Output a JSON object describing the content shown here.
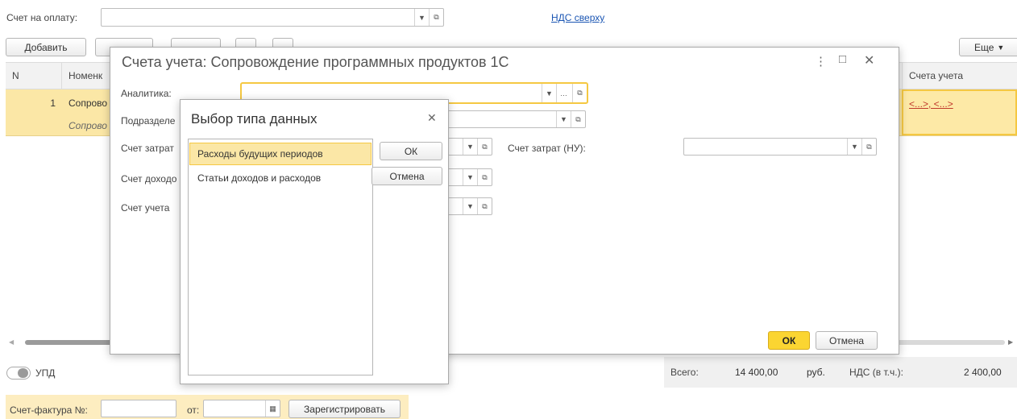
{
  "invoice": {
    "label": "Счет на оплату:",
    "value": "",
    "vat_link": "НДС сверху"
  },
  "toolbar": {
    "add_label": "Добавить",
    "more_label": "Еще"
  },
  "table": {
    "col_n": "N",
    "col_nomenclature": "Номенк",
    "col_accounts": "Счета учета",
    "row1_n": "1",
    "row1_name": "Сопрово",
    "row1_sub": "Сопрово",
    "row1_accounts_link": "<...>, <...>"
  },
  "accounts_dialog": {
    "title": "Счета учета: Сопровождение программных продуктов 1С",
    "analytics_label": "Аналитика:",
    "department_label": "Подразделе",
    "cost_account_label": "Счет затрат",
    "income_account_label": "Счет доходо",
    "account_label": "Счет учета",
    "cost_account_tax_label": "Счет затрат (НУ):",
    "ok_label": "ОК",
    "cancel_label": "Отмена"
  },
  "type_dialog": {
    "title": "Выбор типа данных",
    "items": [
      "Расходы будущих периодов",
      "Статьи доходов и расходов"
    ],
    "ok_label": "ОК",
    "cancel_label": "Отмена"
  },
  "footer": {
    "upd_label": "УПД",
    "total_label": "Всего:",
    "total_value": "14 400,00",
    "currency": "руб.",
    "vat_label": "НДС (в т.ч.):",
    "vat_value": "2 400,00",
    "invoice_no_label": "Счет-фактура №:",
    "from_label": "от:",
    "register_label": "Зарегистрировать"
  },
  "colors": {
    "selection": "#fbe7a6",
    "focus": "#f5c842",
    "primary_button": "#fbd532",
    "link": "#1a55b3"
  }
}
